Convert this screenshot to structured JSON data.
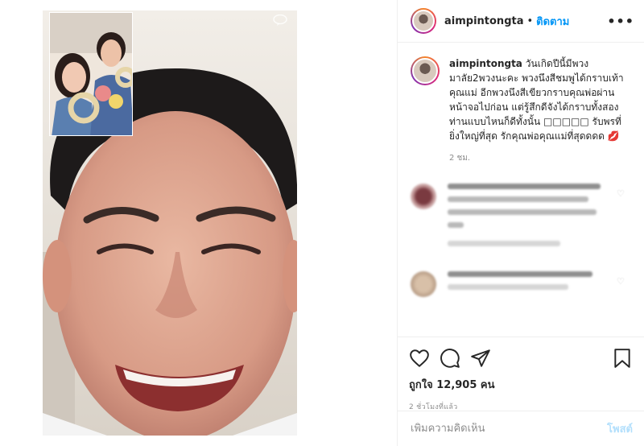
{
  "post": {
    "username": "aimpintongta",
    "follow_label": "ติดตาม",
    "separator": "•",
    "more_label": "•••"
  },
  "caption": {
    "username": "aimpintongta",
    "text": "วันเกิดปีนี้มีพวงมาลัย2พวงนะคะ พวงนึงสีชมพูได้กราบเท้าคุณแม่ อีกพวงนึงสีเขียวกราบคุณพ่อผ่านหน้าจอไปก่อน แต่รู้สึกดีจังได้กราบทั้งสองท่านแบบไหนก็ดีทั้งนั้น □□□□□ รับพรที่ยิ่งใหญ่ที่สุด รักคุณพ่อคุณแม่ที่สุดดดด 💋",
    "time": "2 ชม."
  },
  "actions": {
    "likes": "ถูกใจ 12,905 คน",
    "posted_time": "2 ชั่วโมงที่แล้ว",
    "icons": [
      "heart-icon",
      "comment-icon",
      "share-icon",
      "bookmark-icon"
    ]
  },
  "add_comment": {
    "placeholder": "เพิ่มความคิดเห็น",
    "post_label": "โพสต์"
  },
  "colors": {
    "link_blue": "#0095f6",
    "post_disabled": "#b2dffc",
    "muted": "#8e8e8e"
  }
}
